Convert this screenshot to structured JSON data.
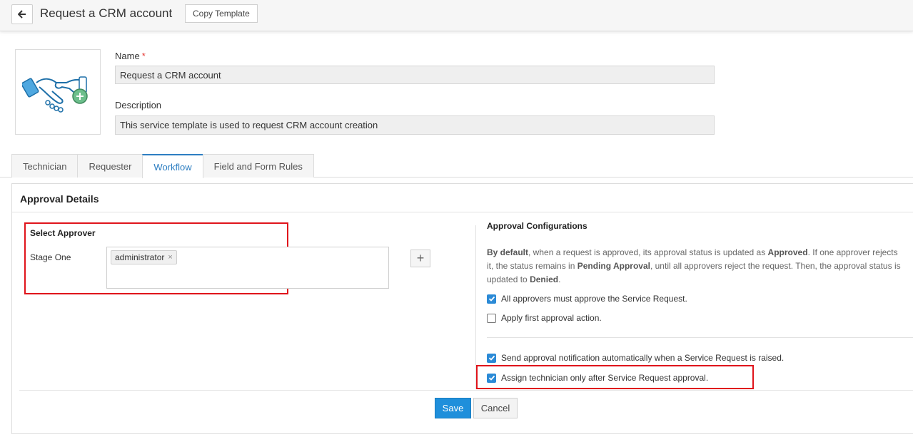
{
  "header": {
    "title": "Request a CRM account",
    "copy_template_label": "Copy Template"
  },
  "form": {
    "name_label": "Name",
    "required_mark": "*",
    "name_value": "Request a CRM account",
    "description_label": "Description",
    "description_value": "This service template is used to request CRM account creation"
  },
  "tabs": [
    {
      "label": "Technician",
      "active": false
    },
    {
      "label": "Requester",
      "active": false
    },
    {
      "label": "Workflow",
      "active": true
    },
    {
      "label": "Field and Form Rules",
      "active": false
    }
  ],
  "approval": {
    "section_title": "Approval Details",
    "select_approver_title": "Select Approver",
    "stage_label": "Stage One",
    "approvers": [
      "administrator"
    ],
    "remove_glyph": "×",
    "add_glyph": "+"
  },
  "config": {
    "title": "Approval Configurations",
    "desc": {
      "p1": "By default",
      "p2": ", when a request is approved, its approval status is updated as ",
      "p3": "Approved",
      "p4": ". If one approver rejects it, the status remains in ",
      "p5": "Pending Approval",
      "p6": ", until all approvers reject the request. Then, the approval status is updated to ",
      "p7": "Denied",
      "p8": "."
    },
    "options": [
      {
        "label": "All approvers must approve the Service Request.",
        "checked": true
      },
      {
        "label": "Apply first approval action.",
        "checked": false
      },
      {
        "label": "Send approval notification automatically when a Service Request is raised.",
        "checked": true
      },
      {
        "label": "Assign technician only after Service Request approval.",
        "checked": true
      }
    ]
  },
  "actions": {
    "save_label": "Save",
    "cancel_label": "Cancel"
  },
  "colors": {
    "accent": "#1f8fdb",
    "highlight_border": "#e0141b",
    "active_tab": "#2d7ec2"
  }
}
